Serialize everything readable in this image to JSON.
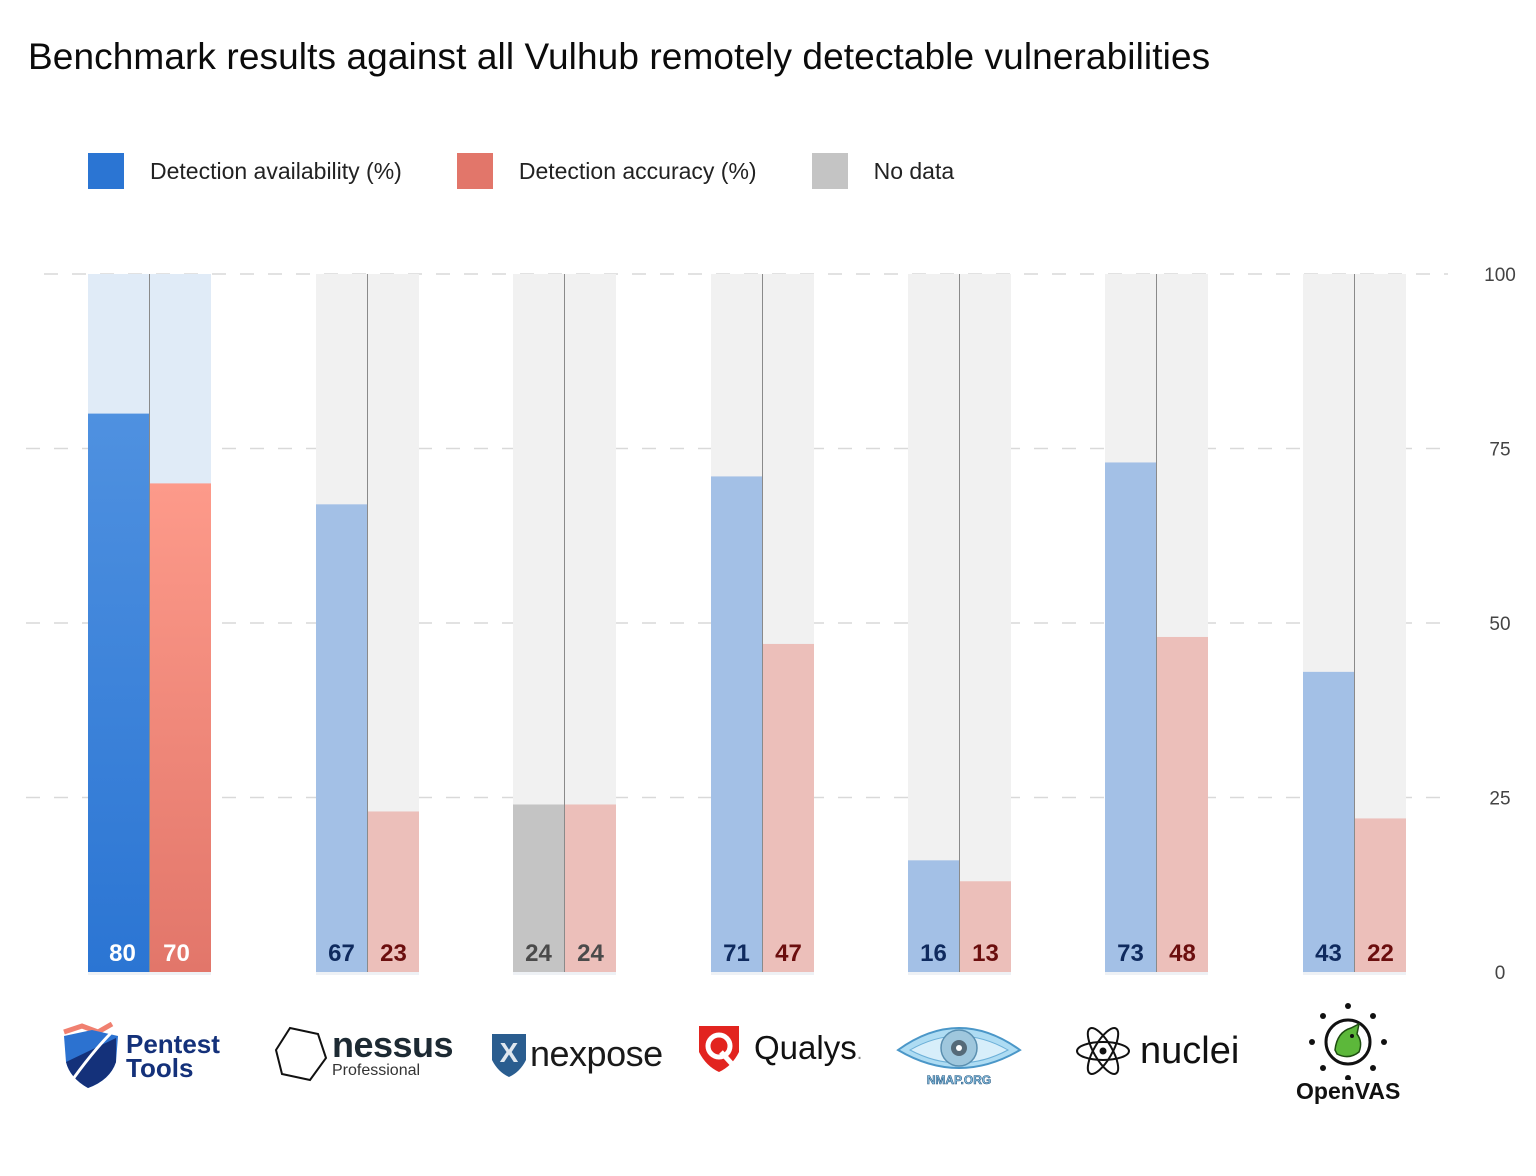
{
  "title": "Benchmark results against all Vulhub remotely detectable vulnerabilities",
  "legend": [
    {
      "label": "Detection availability (%)",
      "color": "#2b75d3"
    },
    {
      "label": "Detection accuracy (%)",
      "color": "#e2766a"
    },
    {
      "label": "No data",
      "color": "#c4c4c4"
    }
  ],
  "colors": {
    "highlight_availability": "#2b75d3",
    "highlight_accuracy": "#e2766a",
    "highlight_background": "#e0ebf7",
    "muted_availability": "#a3c0e6",
    "muted_accuracy": "#ecbfba",
    "muted_background": "#f1f1f1",
    "no_data": "#c4c4c4",
    "label_availability_dark": "#0f2a5e",
    "label_accuracy_dark": "#6b0e0e",
    "label_no_data": "#4a4a4a",
    "label_highlight": "#ffffff",
    "gridline": "#d9d9d9"
  },
  "logos": {
    "pentest": {
      "line1": "Pentest",
      "line2": "Tools"
    },
    "nessus": {
      "name": "nessus",
      "sub": "Professional"
    },
    "nexpose": {
      "name": "nexpose",
      "mark": "X"
    },
    "qualys": {
      "name": "Qualys",
      "mark": "."
    },
    "nmap": {
      "name": "NMAP.ORG"
    },
    "nuclei": {
      "name": "nuclei"
    },
    "openvas": {
      "name": "OpenVAS"
    }
  },
  "chart_data": {
    "type": "bar",
    "title": "Benchmark results against all Vulhub remotely detectable vulnerabilities",
    "xlabel": "",
    "ylabel": "",
    "ylim": [
      0,
      100
    ],
    "yticks": [
      0,
      25,
      50,
      75,
      100
    ],
    "y_axis_position": "right",
    "grid": true,
    "legend_position": "top-left",
    "categories": [
      "Pentest-Tools",
      "Nessus Professional",
      "Nexpose",
      "Qualys",
      "Nmap",
      "Nuclei",
      "OpenVAS"
    ],
    "series": [
      {
        "name": "Detection availability (%)",
        "values": [
          80,
          67,
          24,
          71,
          16,
          73,
          43
        ],
        "no_data": [
          false,
          false,
          true,
          false,
          false,
          false,
          false
        ]
      },
      {
        "name": "Detection accuracy (%)",
        "values": [
          70,
          23,
          24,
          47,
          13,
          48,
          22
        ],
        "no_data": [
          false,
          false,
          false,
          false,
          false,
          false,
          false
        ]
      }
    ],
    "highlighted_category": "Pentest-Tools"
  }
}
